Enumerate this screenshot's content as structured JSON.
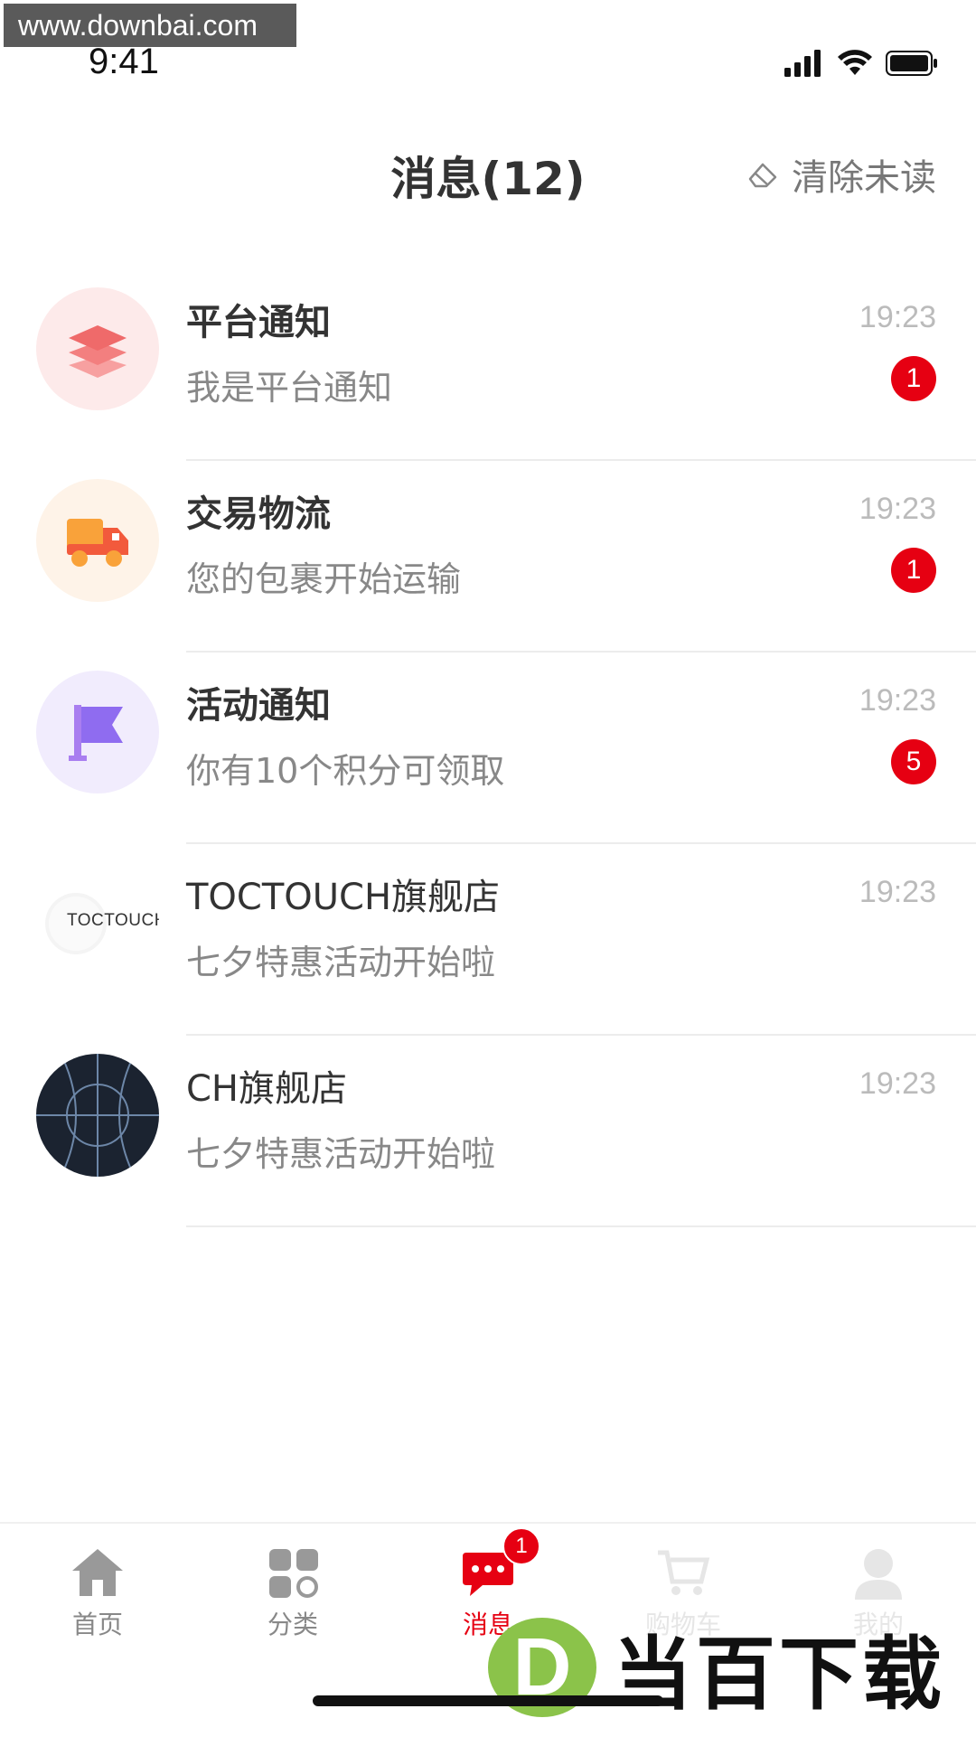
{
  "watermark_top": "www.downbai.com",
  "status_bar": {
    "time": "9:41"
  },
  "header": {
    "title": "消息(12)",
    "clear_unread": "清除未读"
  },
  "messages": [
    {
      "title": "平台通知",
      "subtitle": "我是平台通知",
      "time": "19:23",
      "badge": "1",
      "icon": "layers-icon",
      "bg": "#fdeaea"
    },
    {
      "title": "交易物流",
      "subtitle": "您的包裹开始运输",
      "time": "19:23",
      "badge": "1",
      "icon": "truck-icon",
      "bg": "#fef3e8"
    },
    {
      "title": "活动通知",
      "subtitle": "你有10个积分可领取",
      "time": "19:23",
      "badge": "5",
      "icon": "flag-icon",
      "bg": "#f1ecfd"
    },
    {
      "title": "TOCTOUCH旗舰店",
      "subtitle": "七夕特惠活动开始啦",
      "time": "19:23",
      "badge": "",
      "logo_text": "TOCTOUCH"
    },
    {
      "title": "CH旗舰店",
      "subtitle": "七夕特惠活动开始啦",
      "time": "19:23",
      "badge": ""
    }
  ],
  "tabbar": {
    "items": [
      {
        "label": "首页",
        "icon": "home-icon"
      },
      {
        "label": "分类",
        "icon": "category-icon"
      },
      {
        "label": "消息",
        "icon": "message-icon",
        "badge": "1",
        "active": true
      },
      {
        "label": "购物车",
        "icon": "cart-icon"
      },
      {
        "label": "我的",
        "icon": "user-icon"
      }
    ]
  },
  "watermark_bottom": {
    "logo": "D",
    "text": "当百下载"
  },
  "colors": {
    "accent": "#e60012",
    "time_gray": "#bbbbbb",
    "subtitle_gray": "#888888"
  }
}
